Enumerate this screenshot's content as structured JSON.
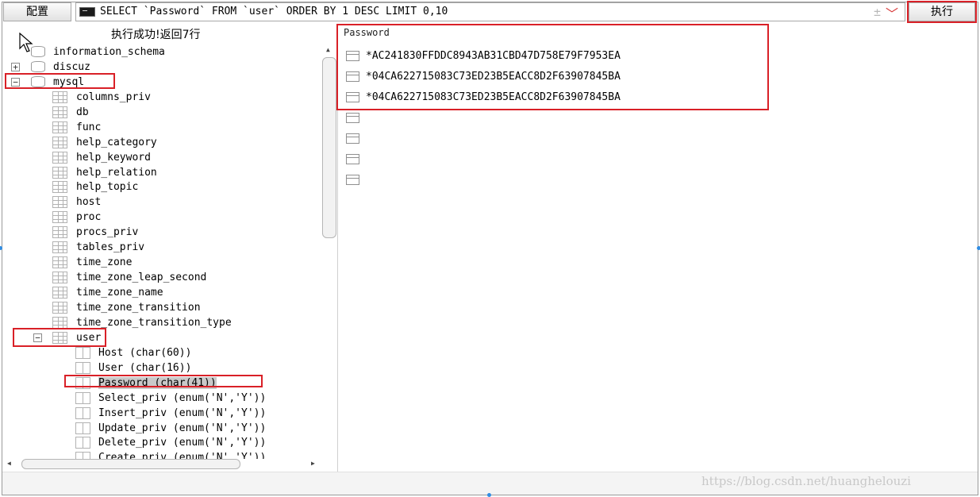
{
  "toolbar": {
    "config_label": "配置",
    "sql_query": "SELECT `Password` FROM `user` ORDER BY 1 DESC LIMIT 0,10",
    "plus_minus": "±",
    "chevron": "﹀",
    "run_label": "执行"
  },
  "status": {
    "message": "执行成功!返回7行"
  },
  "tree": {
    "databases": [
      {
        "name": "information_schema",
        "expanded": false,
        "icon": "database-icon"
      },
      {
        "name": "discuz",
        "expanded": false,
        "expander": "+",
        "icon": "database-icon"
      },
      {
        "name": "mysql",
        "expanded": true,
        "expander": "−",
        "icon": "database-icon"
      }
    ],
    "tables": [
      "columns_priv",
      "db",
      "func",
      "help_category",
      "help_keyword",
      "help_relation",
      "help_topic",
      "host",
      "proc",
      "procs_priv",
      "tables_priv",
      "time_zone",
      "time_zone_leap_second",
      "time_zone_name",
      "time_zone_transition",
      "time_zone_transition_type"
    ],
    "expanded_table": {
      "name": "user",
      "expander": "−"
    },
    "columns": [
      "Host (char(60))",
      "User (char(16))",
      "Password (char(41))",
      "Select_priv (enum('N','Y'))",
      "Insert_priv (enum('N','Y'))",
      "Update_priv (enum('N','Y'))",
      "Delete_priv (enum('N','Y'))",
      "Create_priv (enum('N','Y'))"
    ],
    "selected_column": "Password (char(41))"
  },
  "results": {
    "column_header": "Password",
    "rows": [
      "*AC241830FFDDC8943AB31CBD47D758E79F7953EA",
      "*04CA622715083C73ED23B5EACC8D2F63907845BA",
      "*04CA622715083C73ED23B5EACC8D2F63907845BA",
      "",
      "",
      "",
      ""
    ]
  },
  "watermark": "https://blog.csdn.net/huanghelouzi",
  "colors": {
    "annotation_red": "#d92027",
    "selection_gray": "#c9c9c9"
  }
}
